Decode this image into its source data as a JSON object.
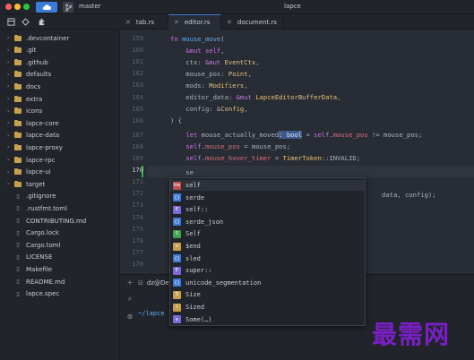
{
  "titlebar": {
    "branch": "master",
    "window_title": "lapce",
    "cloud_icon": "cloud-icon",
    "branch_icon": "git-branch-icon"
  },
  "sidebar": {
    "tabs": [
      "file-explorer-icon",
      "search-icon",
      "git-icon"
    ],
    "items": [
      {
        "label": ".devcontainer",
        "type": "folder"
      },
      {
        "label": ".git",
        "type": "folder"
      },
      {
        "label": ".github",
        "type": "folder"
      },
      {
        "label": "defaults",
        "type": "folder"
      },
      {
        "label": "docs",
        "type": "folder"
      },
      {
        "label": "extra",
        "type": "folder"
      },
      {
        "label": "icons",
        "type": "folder"
      },
      {
        "label": "lapce-core",
        "type": "folder"
      },
      {
        "label": "lapce-data",
        "type": "folder"
      },
      {
        "label": "lapce-proxy",
        "type": "folder"
      },
      {
        "label": "lapce-rpc",
        "type": "folder"
      },
      {
        "label": "lapce-ui",
        "type": "folder"
      },
      {
        "label": "target",
        "type": "folder"
      },
      {
        "label": ".gitignore",
        "type": "file"
      },
      {
        "label": ".rustfmt.toml",
        "type": "file"
      },
      {
        "label": "CONTRIBUTING.md",
        "type": "file"
      },
      {
        "label": "Cargo.lock",
        "type": "file"
      },
      {
        "label": "Cargo.toml",
        "type": "file"
      },
      {
        "label": "LICENSE",
        "type": "file"
      },
      {
        "label": "Makefile",
        "type": "file"
      },
      {
        "label": "README.md",
        "type": "file"
      },
      {
        "label": "lapce.spec",
        "type": "file"
      }
    ]
  },
  "editor_tabs": [
    {
      "label": "tab.rs",
      "active": false
    },
    {
      "label": "editor.rs",
      "active": true
    },
    {
      "label": "document.rs",
      "active": false
    }
  ],
  "editor": {
    "line_numbers": [
      "159",
      "160",
      "161",
      "162",
      "163",
      "164",
      "165",
      "166",
      "167",
      "168",
      "169",
      "170",
      "171",
      "172",
      "173",
      "174",
      "175",
      "176",
      "177",
      "178"
    ],
    "current_line": "170",
    "lines": [
      "fn mouse_move(",
      "    &mut self,",
      "    ctx: &mut EventCtx,",
      "    mouse_pos: Point,",
      "    mods: Modifiers,",
      "    editor_data: &mut LapceEditorBufferData,",
      "    config: &Config,",
      ") {",
      "    let mouse_actually_moved: bool = self.mouse_pos != mouse_pos;",
      "    self.mouse_pos = mouse_pos;",
      "    self.mouse_hover_timer = TimerToken::INVALID;",
      "    se",
      "",
      "",
      "",
      "",
      "",
      "",
      "",
      ""
    ],
    "trailing_text": "data, config);"
  },
  "completion": {
    "items": [
      {
        "label": "self",
        "kind": "keyword",
        "color": "#c0504d"
      },
      {
        "label": "serde",
        "kind": "module",
        "color": "#3e7bd6"
      },
      {
        "label": "self::",
        "kind": "enum",
        "color": "#7a6ad8"
      },
      {
        "label": "serde_json",
        "kind": "module",
        "color": "#3e7bd6"
      },
      {
        "label": "Self",
        "kind": "struct",
        "color": "#3fa34d"
      },
      {
        "label": "$end",
        "kind": "variable",
        "color": "#c7a04d"
      },
      {
        "label": "sled",
        "kind": "module",
        "color": "#3e7bd6"
      },
      {
        "label": "super::",
        "kind": "enum",
        "color": "#7a6ad8"
      },
      {
        "label": "unicode_segmentation",
        "kind": "module",
        "color": "#3e7bd6"
      },
      {
        "label": "Size",
        "kind": "struct",
        "color": "#c7a04d"
      },
      {
        "label": "Sized",
        "kind": "interface",
        "color": "#c7a04d"
      },
      {
        "label": "Some(…)",
        "kind": "enum-member",
        "color": "#7a6ad8"
      }
    ]
  },
  "terminal": {
    "tab_label": "dz@De",
    "prompt": "~/lapce",
    "side_icons": [
      "plus-icon",
      "split-icon",
      "close-icon"
    ]
  },
  "watermark": "最需网"
}
